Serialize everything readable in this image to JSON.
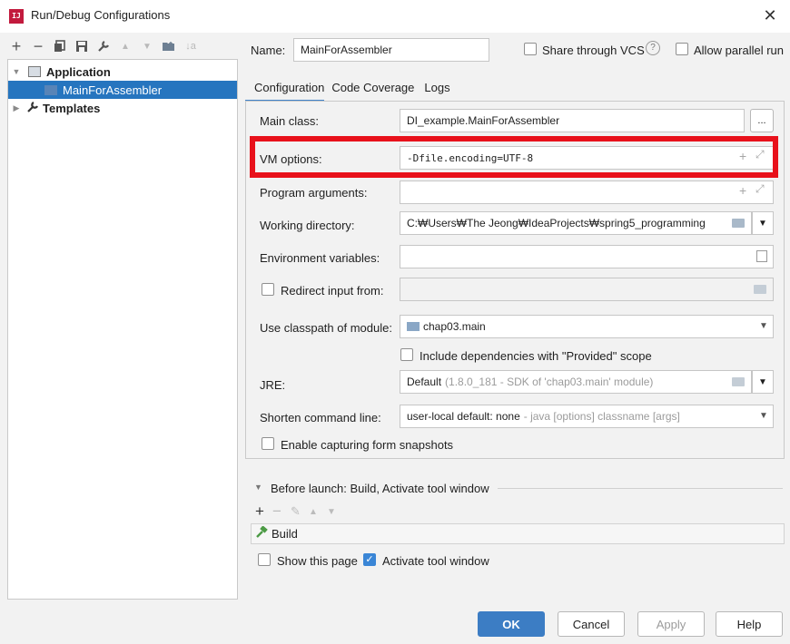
{
  "window": {
    "title": "Run/Debug Configurations",
    "close": "✕",
    "app_icon_text": "IJ"
  },
  "toolbar": {
    "add": "+",
    "remove": "−",
    "copy": "⧉",
    "save": "🖫",
    "edit": "🔧",
    "up": "▲",
    "down": "▼",
    "folder": "📁",
    "sort": "↓a"
  },
  "tree": {
    "application": "Application",
    "selected_config": "MainForAssembler",
    "templates": "Templates"
  },
  "form": {
    "name_label": "Name:",
    "name_value": "MainForAssembler",
    "share_vcs": "Share through VCS",
    "allow_parallel": "Allow parallel run",
    "help_glyph": "?"
  },
  "tabs": [
    "Configuration",
    "Code Coverage",
    "Logs"
  ],
  "config": {
    "main_class_label": "Main class:",
    "main_class_value": "DI_example.MainForAssembler",
    "main_class_btn": "...",
    "vm_options_label": "VM options:",
    "vm_options_value": "-Dfile.encoding=UTF-8",
    "program_args_label": "Program arguments:",
    "working_dir_label": "Working directory:",
    "working_dir_value": "C:₩Users₩The Jeong₩IdeaProjects₩spring5_programming",
    "env_vars_label": "Environment variables:",
    "redirect_label": "Redirect input from:",
    "classpath_label": "Use classpath of module:",
    "classpath_value": "chap03.main",
    "include_deps_label": "Include dependencies with \"Provided\" scope",
    "jre_label": "JRE:",
    "jre_value": "Default",
    "jre_detail": "(1.8.0_181 - SDK of 'chap03.main' module)",
    "shorten_label": "Shorten command line:",
    "shorten_value": "user-local default: none",
    "shorten_detail": "- java [options] classname [args]",
    "form_snapshots_label": "Enable capturing form snapshots"
  },
  "before_launch": {
    "title": "Before launch: Build, Activate tool window",
    "item": "Build",
    "show_page": "Show this page",
    "activate_tool": "Activate tool window"
  },
  "buttons": {
    "ok": "OK",
    "cancel": "Cancel",
    "apply": "Apply",
    "help": "Help"
  }
}
